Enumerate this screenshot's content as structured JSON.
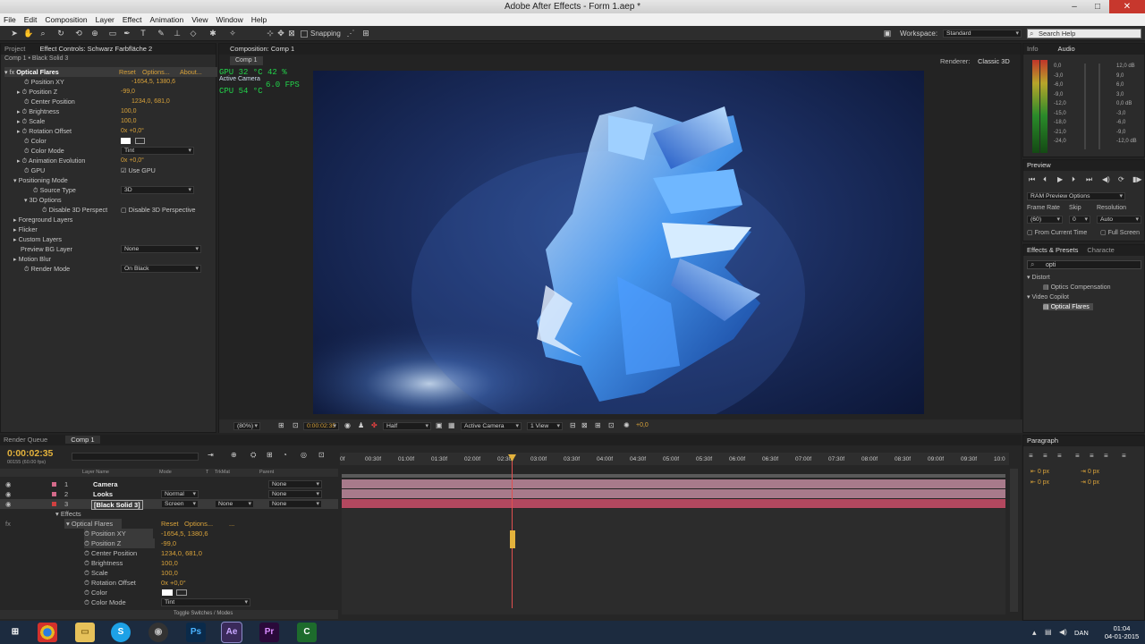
{
  "window": {
    "title": "Adobe After Effects - Form 1.aep *",
    "min": "‒",
    "max": "□",
    "close": "✕"
  },
  "menu": [
    "File",
    "Edit",
    "Composition",
    "Layer",
    "Effect",
    "Animation",
    "View",
    "Window",
    "Help"
  ],
  "toolbar": {
    "snapping": "Snapping",
    "workspace_label": "Workspace:",
    "workspace_value": "Standard",
    "search_placeholder": "Search Help"
  },
  "effect_controls": {
    "tab_project": "Project",
    "tab": "Effect Controls: Schwarz Farbfläche 2",
    "breadcrumb": "Comp 1 • Black Solid 3",
    "effect_name": "Optical Flares",
    "reset": "Reset",
    "options": "Options...",
    "about": "About...",
    "props": [
      {
        "name": "Position XY",
        "value": "-1654,5, 1380,6"
      },
      {
        "name": "Position Z",
        "value": "-99,0"
      },
      {
        "name": "Center Position",
        "value": "1234,0, 681,0"
      },
      {
        "name": "Brightness",
        "value": "100,0"
      },
      {
        "name": "Scale",
        "value": "100,0"
      },
      {
        "name": "Rotation Offset",
        "value": "0x +0,0°"
      },
      {
        "name": "Color",
        "value": ""
      },
      {
        "name": "Color Mode",
        "value": "Tint"
      },
      {
        "name": "Animation Evolution",
        "value": "0x +0,0°"
      },
      {
        "name": "GPU",
        "value": "Use GPU"
      },
      {
        "name": "Positioning Mode",
        "value": ""
      },
      {
        "name": "Source Type",
        "value": "3D"
      },
      {
        "name": "3D Options",
        "value": ""
      },
      {
        "name": "Disable 3D Perspect",
        "value": "Disable 3D Perspective"
      },
      {
        "name": "Foreground Layers",
        "value": ""
      },
      {
        "name": "Flicker",
        "value": ""
      },
      {
        "name": "Custom Layers",
        "value": ""
      },
      {
        "name": "Preview BG Layer",
        "value": "None"
      },
      {
        "name": "Motion Blur",
        "value": ""
      },
      {
        "name": "Render Mode",
        "value": "On Black"
      }
    ]
  },
  "composition": {
    "tab": "Composition: Comp 1",
    "breadcrumb": "Comp 1",
    "renderer_label": "Renderer:",
    "renderer": "Classic 3D",
    "hud_line1": "GPU   32 °C 42 %",
    "hud_line2": "Active Camera",
    "hud_fps": "6.0 FPS",
    "hud_line3": "CPU   54 °C",
    "zoom": "(80%)",
    "timecode": "0:00:02:35",
    "resolution": "Half",
    "camera": "Active Camera",
    "views": "1 View",
    "exposure": "+0,0"
  },
  "info": {
    "tab_info": "Info",
    "tab_audio": "Audio",
    "db_left": [
      "0,0",
      "-3,0",
      "-6,0",
      "-9,0",
      "-12,0",
      "-15,0",
      "-18,0",
      "-21,0",
      "-24,0"
    ],
    "db_right": [
      "12,0 dB",
      "9,0",
      "6,0",
      "3,0",
      "0,0 dB",
      "-3,0",
      "-6,0",
      "-9,0",
      "-12,0 dB"
    ]
  },
  "preview": {
    "tab": "Preview",
    "ram": "RAM Preview Options",
    "frame_rate_label": "Frame Rate",
    "skip_label": "Skip",
    "resolution_label": "Resolution",
    "frame_rate": "(60)",
    "skip": "0",
    "resolution": "Auto",
    "from_current": "From Current Time",
    "full_screen": "Full Screen"
  },
  "effects_presets": {
    "tab": "Effects & Presets",
    "tab2": "Characte",
    "search": "opti",
    "items": [
      {
        "label": "Distort",
        "indent": 0
      },
      {
        "label": "Optics Compensation",
        "indent": 1
      },
      {
        "label": "Video Copilot",
        "indent": 0
      },
      {
        "label": "Optical Flares",
        "indent": 1
      }
    ]
  },
  "paragraph": {
    "tab": "Paragraph",
    "left_indent": "0 px",
    "first_indent": "0 px",
    "right_indent": "0 px",
    "after": "0 px"
  },
  "timeline": {
    "tab_render": "Render Queue",
    "tab_comp": "Comp 1",
    "timecode": "0:00:02:35",
    "frames": "00155 (60.00 fps)",
    "col_name": "Layer Name",
    "col_mode": "Mode",
    "col_t": "T",
    "col_trkmat": "TrkMat",
    "col_parent": "Parent",
    "layers": [
      {
        "num": "1",
        "name": "Camera",
        "mode": "",
        "parent": "None"
      },
      {
        "num": "2",
        "name": "Looks",
        "mode": "Normal",
        "parent": "None"
      },
      {
        "num": "3",
        "name": "[Black Solid 3]",
        "mode": "Screen",
        "trkmat": "None",
        "parent": "None"
      }
    ],
    "effects_label": "Effects",
    "effect": "Optical Flares",
    "reset": "Reset",
    "options": "Options...",
    "dots": "...",
    "props": [
      {
        "name": "Position XY",
        "value": "-1654,5, 1380,6"
      },
      {
        "name": "Position Z",
        "value": "-99,0"
      },
      {
        "name": "Center Position",
        "value": "1234,0, 681,0"
      },
      {
        "name": "Brightness",
        "value": "100,0"
      },
      {
        "name": "Scale",
        "value": "100,0"
      },
      {
        "name": "Rotation Offset",
        "value": "0x +0,0°"
      },
      {
        "name": "Color",
        "value": ""
      },
      {
        "name": "Color Mode",
        "value": "Tint"
      }
    ],
    "ruler": [
      "0f",
      "00:30f",
      "01:00f",
      "01:30f",
      "02:00f",
      "02:30f",
      "03:00f",
      "03:30f",
      "04:00f",
      "04:30f",
      "05:00f",
      "05:30f",
      "06:00f",
      "06:30f",
      "07:00f",
      "07:30f",
      "08:00f",
      "08:30f",
      "09:00f",
      "09:30f",
      "10:0"
    ],
    "toggle": "Toggle Switches / Modes"
  },
  "taskbar": {
    "lang": "DAN",
    "time": "01:04",
    "date": "04-01-2015",
    "apps": [
      "chrome",
      "explorer",
      "skype",
      "obs",
      "Ps",
      "Ae",
      "Pr",
      "camtasia"
    ]
  }
}
